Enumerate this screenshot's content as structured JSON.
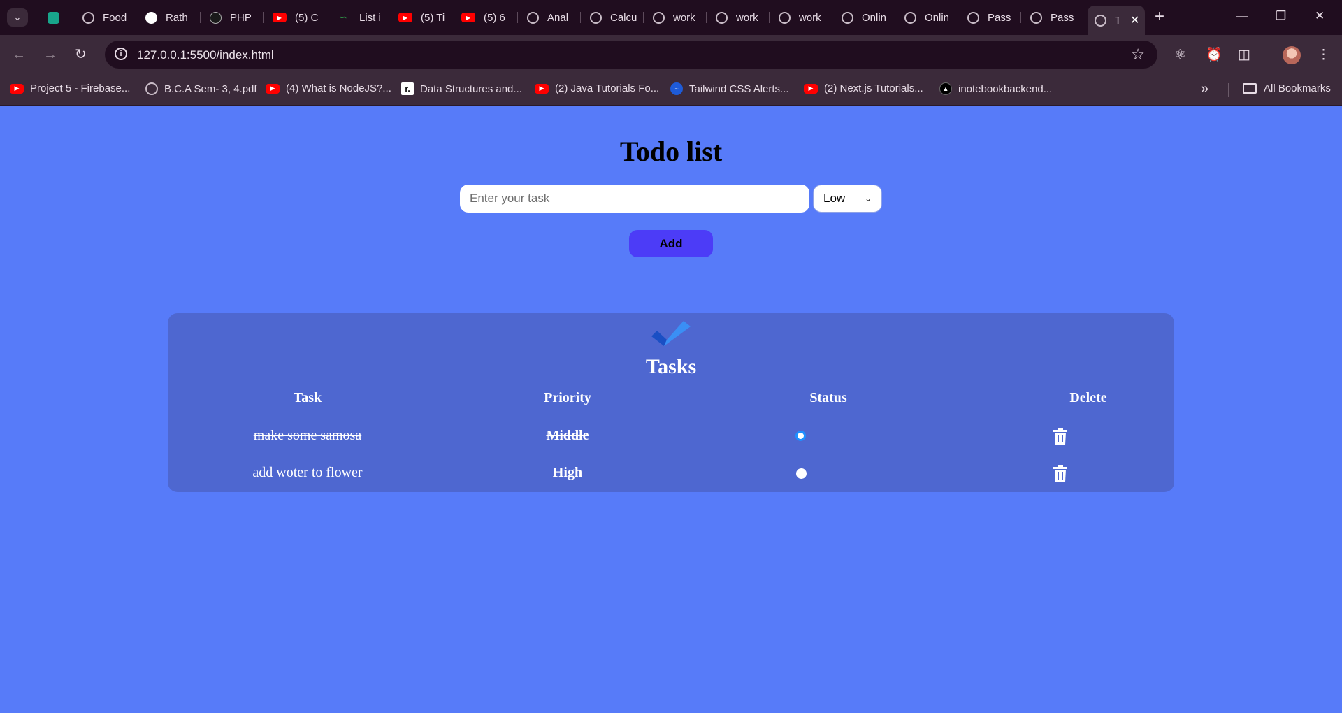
{
  "browser": {
    "tabs": [
      {
        "label": "",
        "icon": "green-app-icon"
      },
      {
        "label": "Food",
        "icon": "globe-icon"
      },
      {
        "label": "Rath",
        "icon": "github-icon"
      },
      {
        "label": "PHP",
        "icon": "chatgpt-icon"
      },
      {
        "label": "(5) C",
        "icon": "youtube-icon"
      },
      {
        "label": "List i",
        "icon": "geeksforgeeks-icon"
      },
      {
        "label": "(5) Ti",
        "icon": "youtube-icon"
      },
      {
        "label": "(5) 6",
        "icon": "youtube-icon"
      },
      {
        "label": "Anal",
        "icon": "globe-icon"
      },
      {
        "label": "Calcu",
        "icon": "globe-icon"
      },
      {
        "label": "work",
        "icon": "globe-icon"
      },
      {
        "label": "work",
        "icon": "globe-icon"
      },
      {
        "label": "work",
        "icon": "globe-icon"
      },
      {
        "label": "Onlin",
        "icon": "globe-icon"
      },
      {
        "label": "Onlin",
        "icon": "globe-icon"
      },
      {
        "label": "Pass",
        "icon": "globe-icon"
      },
      {
        "label": "Pass",
        "icon": "globe-icon"
      },
      {
        "label": "T",
        "icon": "globe-icon",
        "active": true
      }
    ],
    "url": "127.0.0.1:5500/index.html",
    "bookmarks": [
      {
        "label": "Project 5 - Firebase...",
        "icon": "youtube-icon"
      },
      {
        "label": "B.C.A Sem- 3, 4.pdf",
        "icon": "globe-icon"
      },
      {
        "label": "(4) What is NodeJS?...",
        "icon": "youtube-icon"
      },
      {
        "label": "Data Structures and...",
        "icon": "ds-icon"
      },
      {
        "label": "(2) Java Tutorials Fo...",
        "icon": "youtube-icon"
      },
      {
        "label": "Tailwind CSS Alerts...",
        "icon": "tailwind-icon"
      },
      {
        "label": "(2) Next.js Tutorials...",
        "icon": "youtube-icon"
      },
      {
        "label": "inotebookbackend...",
        "icon": "triangle-icon"
      }
    ],
    "all_bookmarks": "All Bookmarks"
  },
  "app": {
    "title": "Todo list",
    "input_placeholder": "Enter your task",
    "input_value": "",
    "priority_selected": "Low",
    "add_label": "Add",
    "colors": {
      "background": "#577bf9",
      "card": "#4e67d0",
      "button": "#4c3cf7"
    }
  },
  "tasks_card": {
    "title": "Tasks",
    "headers": {
      "task": "Task",
      "priority": "Priority",
      "status": "Status",
      "delete": "Delete"
    },
    "rows": [
      {
        "task": "make some samosa",
        "priority": "Middle",
        "done": true
      },
      {
        "task": "add woter to flower",
        "priority": "High",
        "done": false
      }
    ]
  }
}
